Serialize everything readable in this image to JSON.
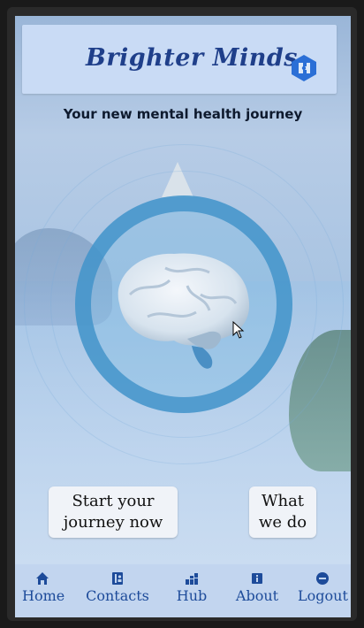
{
  "header": {
    "title": "Brighter Minds",
    "logo_icon": "puzzle-head-icon"
  },
  "hero": {
    "subtitle": "Your new mental health journey",
    "image_icon": "brain-icon"
  },
  "actions": {
    "start_label": "Start your journey now",
    "what_label": "What we do"
  },
  "nav": {
    "items": [
      {
        "label": "Home",
        "icon": "home-icon"
      },
      {
        "label": "Contacts",
        "icon": "contacts-icon"
      },
      {
        "label": "Hub",
        "icon": "hub-icon"
      },
      {
        "label": "About",
        "icon": "info-icon"
      },
      {
        "label": "Logout",
        "icon": "logout-icon"
      }
    ]
  },
  "colors": {
    "accent": "#1f3f8a",
    "nav_text": "#1d4b9a",
    "ring": "#3e91c8",
    "header_bg": "#c9dbf5"
  }
}
